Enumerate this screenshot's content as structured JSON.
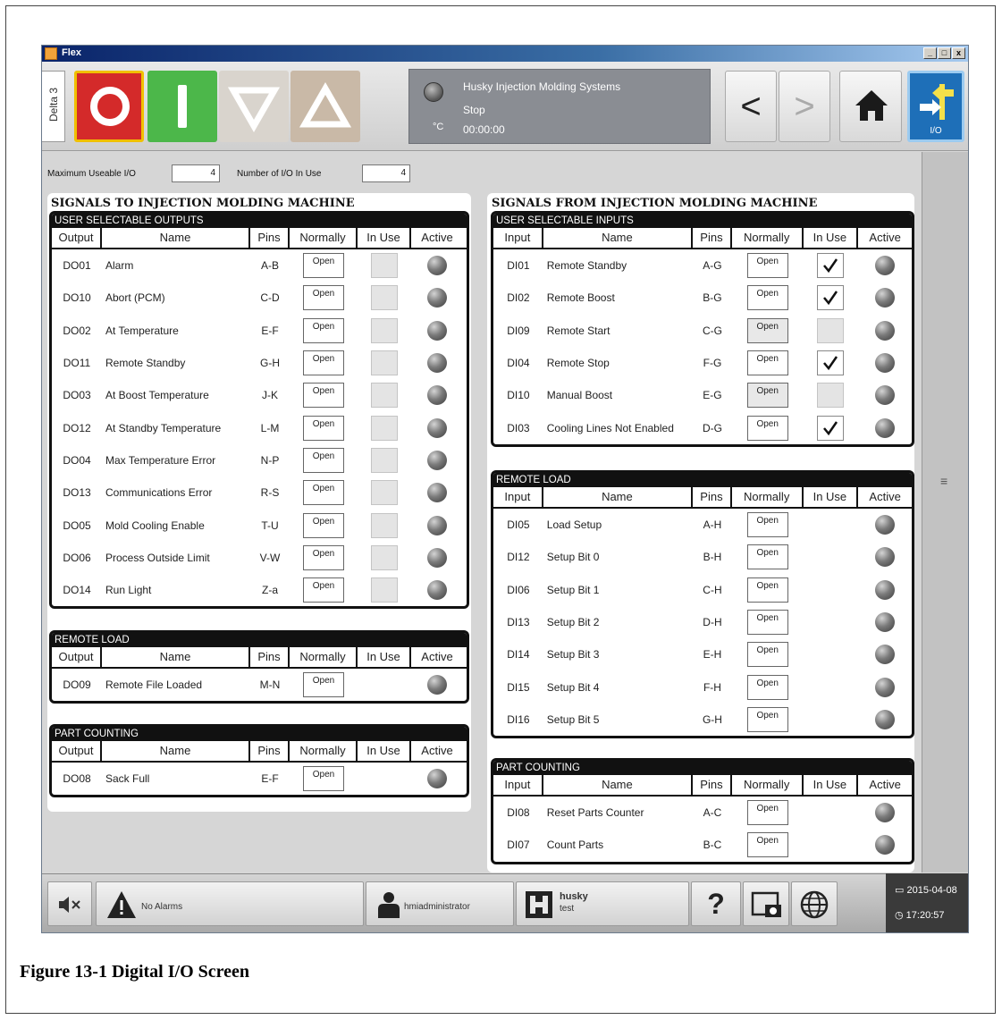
{
  "window": {
    "title": "Flex",
    "min_label": "_",
    "max_label": "□",
    "close_label": "x"
  },
  "toolbar": {
    "delta_tab": "Delta 3",
    "status": {
      "company": "Husky Injection Molding Systems",
      "state": "Stop",
      "time": "00:00:00",
      "unit": "°C"
    },
    "io_label": "I/O",
    "back_glyph": "<",
    "forward_glyph": ">"
  },
  "counters": {
    "max_label": "Maximum Useable I/O",
    "max_value": "4",
    "inuse_label": "Number of I/O In Use",
    "inuse_value": "4"
  },
  "left": {
    "title": "SIGNALS TO INJECTION MOLDING MACHINE",
    "sections": [
      {
        "title": "USER SELECTABLE OUTPUTS",
        "headers": [
          "Output",
          "Name",
          "Pins",
          "Normally",
          "In Use",
          "Active"
        ],
        "rows": [
          {
            "id": "DO01",
            "name": "Alarm",
            "pins": "A-B",
            "normally": "Open",
            "in_use": false
          },
          {
            "id": "DO10",
            "name": "Abort (PCM)",
            "pins": "C-D",
            "normally": "Open",
            "in_use": false
          },
          {
            "id": "DO02",
            "name": "At Temperature",
            "pins": "E-F",
            "normally": "Open",
            "in_use": false
          },
          {
            "id": "DO11",
            "name": "Remote Standby",
            "pins": "G-H",
            "normally": "Open",
            "in_use": false
          },
          {
            "id": "DO03",
            "name": "At Boost Temperature",
            "pins": "J-K",
            "normally": "Open",
            "in_use": false
          },
          {
            "id": "DO12",
            "name": "At Standby Temperature",
            "pins": "L-M",
            "normally": "Open",
            "in_use": false
          },
          {
            "id": "DO04",
            "name": "Max Temperature Error",
            "pins": "N-P",
            "normally": "Open",
            "in_use": false
          },
          {
            "id": "DO13",
            "name": "Communications Error",
            "pins": "R-S",
            "normally": "Open",
            "in_use": false
          },
          {
            "id": "DO05",
            "name": "Mold Cooling Enable",
            "pins": "T-U",
            "normally": "Open",
            "in_use": false
          },
          {
            "id": "DO06",
            "name": "Process Outside Limit",
            "pins": "V-W",
            "normally": "Open",
            "in_use": false
          },
          {
            "id": "DO14",
            "name": "Run Light",
            "pins": "Z-a",
            "normally": "Open",
            "in_use": false
          }
        ]
      },
      {
        "title": "REMOTE LOAD",
        "headers": [
          "Output",
          "Name",
          "Pins",
          "Normally",
          "In Use",
          "Active"
        ],
        "rows": [
          {
            "id": "DO09",
            "name": "Remote File Loaded",
            "pins": "M-N",
            "normally": "Open",
            "in_use": null
          }
        ]
      },
      {
        "title": "PART COUNTING",
        "headers": [
          "Output",
          "Name",
          "Pins",
          "Normally",
          "In Use",
          "Active"
        ],
        "rows": [
          {
            "id": "DO08",
            "name": "Sack Full",
            "pins": "E-F",
            "normally": "Open",
            "in_use": null
          }
        ]
      }
    ]
  },
  "right": {
    "title": "SIGNALS FROM INJECTION MOLDING MACHINE",
    "sections": [
      {
        "title": "USER SELECTABLE INPUTS",
        "headers": [
          "Input",
          "Name",
          "Pins",
          "Normally",
          "In Use",
          "Active"
        ],
        "rows": [
          {
            "id": "DI01",
            "name": "Remote Standby",
            "pins": "A-G",
            "normally": "Open",
            "in_use": true
          },
          {
            "id": "DI02",
            "name": "Remote Boost",
            "pins": "B-G",
            "normally": "Open",
            "in_use": true
          },
          {
            "id": "DI09",
            "name": "Remote Start",
            "pins": "C-G",
            "normally": "Open",
            "in_use": false
          },
          {
            "id": "DI04",
            "name": "Remote Stop",
            "pins": "F-G",
            "normally": "Open",
            "in_use": true
          },
          {
            "id": "DI10",
            "name": "Manual Boost",
            "pins": "E-G",
            "normally": "Open",
            "in_use": false
          },
          {
            "id": "DI03",
            "name": "Cooling Lines Not Enabled",
            "pins": "D-G",
            "normally": "Open",
            "in_use": true
          }
        ]
      },
      {
        "title": "REMOTE LOAD",
        "headers": [
          "Input",
          "Name",
          "Pins",
          "Normally",
          "In Use",
          "Active"
        ],
        "rows": [
          {
            "id": "DI05",
            "name": "Load Setup",
            "pins": "A-H",
            "normally": "Open",
            "in_use": null
          },
          {
            "id": "DI12",
            "name": "Setup Bit 0",
            "pins": "B-H",
            "normally": "Open",
            "in_use": null
          },
          {
            "id": "DI06",
            "name": "Setup Bit 1",
            "pins": "C-H",
            "normally": "Open",
            "in_use": null
          },
          {
            "id": "DI13",
            "name": "Setup Bit 2",
            "pins": "D-H",
            "normally": "Open",
            "in_use": null
          },
          {
            "id": "DI14",
            "name": "Setup Bit 3",
            "pins": "E-H",
            "normally": "Open",
            "in_use": null
          },
          {
            "id": "DI15",
            "name": "Setup Bit 4",
            "pins": "F-H",
            "normally": "Open",
            "in_use": null
          },
          {
            "id": "DI16",
            "name": "Setup Bit 5",
            "pins": "G-H",
            "normally": "Open",
            "in_use": null
          }
        ]
      },
      {
        "title": "PART COUNTING",
        "headers": [
          "Input",
          "Name",
          "Pins",
          "Normally",
          "In Use",
          "Active"
        ],
        "rows": [
          {
            "id": "DI08",
            "name": "Reset Parts Counter",
            "pins": "A-C",
            "normally": "Open",
            "in_use": null
          },
          {
            "id": "DI07",
            "name": "Count Parts",
            "pins": "B-C",
            "normally": "Open",
            "in_use": null
          }
        ]
      }
    ]
  },
  "bottombar": {
    "alarms": "No Alarms",
    "user": "hmiadministrator",
    "profile_name": "husky",
    "profile_sub": "test",
    "help_glyph": "?",
    "date": "2015-04-08",
    "time": "17:20:57"
  },
  "caption": "Figure 13-1  Digital I/O Screen",
  "colors": {
    "stop_red": "#d42a2a",
    "start_green": "#4cb74a",
    "io_blue": "#1e6fb8",
    "header_black": "#111111"
  }
}
